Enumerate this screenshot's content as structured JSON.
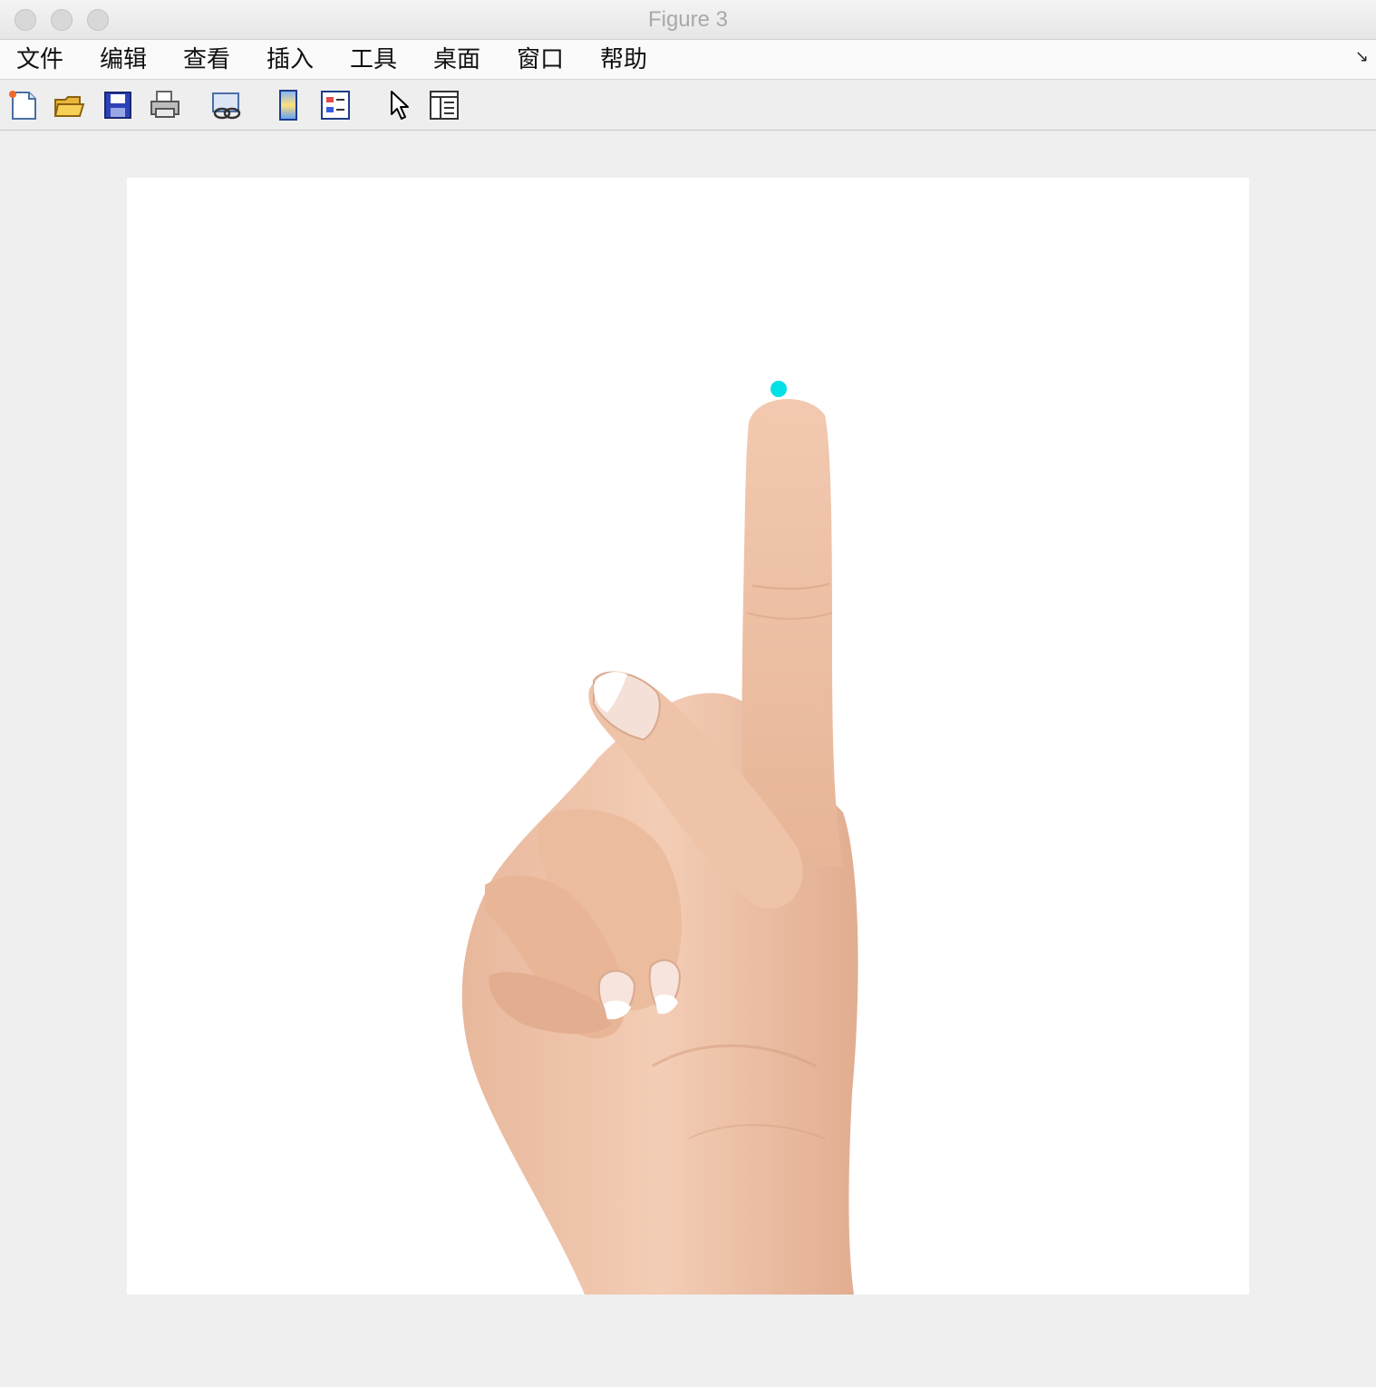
{
  "window": {
    "title": "Figure 3"
  },
  "menu": {
    "items": [
      {
        "label": "文件"
      },
      {
        "label": "编辑"
      },
      {
        "label": "查看"
      },
      {
        "label": "插入"
      },
      {
        "label": "工具"
      },
      {
        "label": "桌面"
      },
      {
        "label": "窗口"
      },
      {
        "label": "帮助"
      }
    ]
  },
  "toolbar": {
    "buttons": [
      {
        "icon": "new-figure-icon"
      },
      {
        "icon": "open-file-icon"
      },
      {
        "icon": "save-icon"
      },
      {
        "icon": "print-icon"
      },
      {
        "icon": "link-plot-icon"
      },
      {
        "icon": "insert-colorbar-icon"
      },
      {
        "icon": "insert-legend-icon"
      },
      {
        "icon": "edit-plot-arrow-icon"
      },
      {
        "icon": "property-inspector-icon"
      }
    ]
  },
  "colors": {
    "marker": "#00e0e6",
    "skin": "#f0c7ad"
  }
}
